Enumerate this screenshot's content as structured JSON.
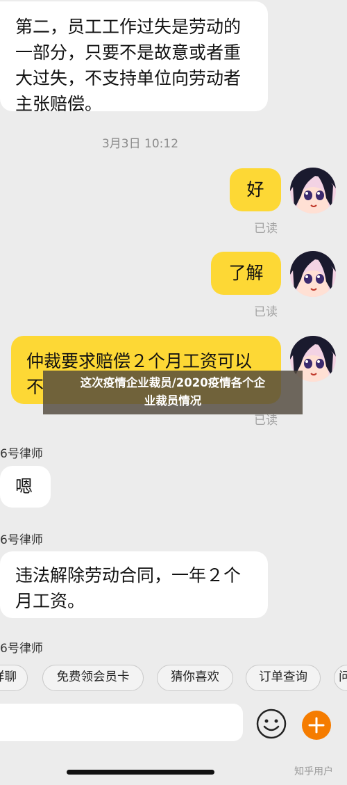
{
  "messages": {
    "m1": {
      "line1": "第二，员工工作过失是劳动的",
      "line2": "一部分，只要不是故意或者重",
      "line3": "大过失，不支持单位向劳动者",
      "line4": "主张赔偿。"
    },
    "timestamp": "3月3日 10:12",
    "m2": {
      "text": "好",
      "status": "已读"
    },
    "m3": {
      "text": "了解",
      "status": "已读"
    },
    "m4": {
      "line1": "仲裁要求赔偿２个月工资可以",
      "line2": "不",
      "status": "已读"
    },
    "m5": {
      "sender": "6号律师",
      "text": "嗯"
    },
    "m6": {
      "sender": "6号律师",
      "line1": "违法解除劳动合同，一年２个",
      "line2": "月工资。"
    },
    "m7": {
      "sender": "6号律师"
    }
  },
  "overlay": {
    "line1": "这次疫情企业裁员/2020疫情各个企",
    "line2": "业裁员情况"
  },
  "quick_replies": [
    "咩聊",
    "免费领会员卡",
    "猜你喜欢",
    "订单查询",
    "问"
  ],
  "input": {
    "placeholder": ""
  },
  "icons": {
    "emoji": "smiley-face-icon",
    "plus": "plus-icon",
    "avatar": "anime-girl-avatar"
  },
  "colors": {
    "background": "#ececec",
    "outgoing_bubble": "#fdd835",
    "incoming_bubble": "#ffffff",
    "plus_button": "#f57c00"
  },
  "watermark": "知乎用户"
}
